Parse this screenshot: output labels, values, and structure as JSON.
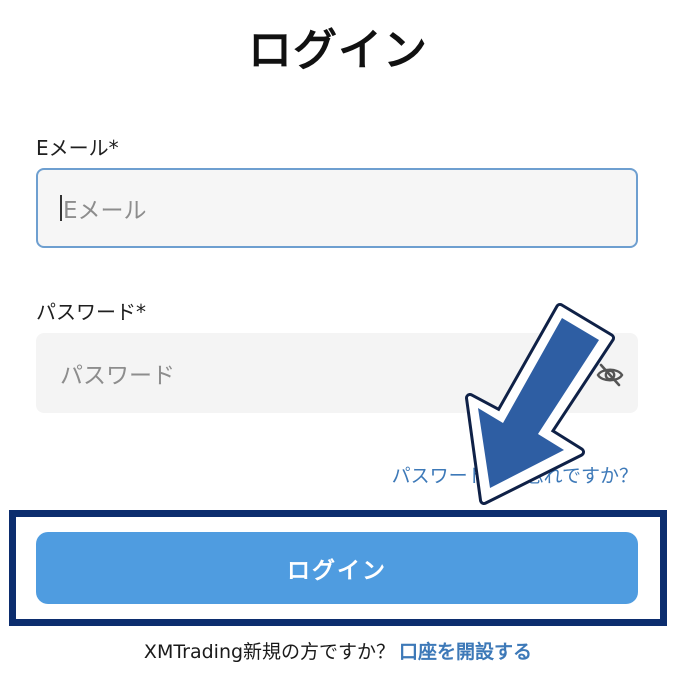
{
  "page": {
    "title": "ログイン"
  },
  "form": {
    "email_label": "Eメール*",
    "email_placeholder": "Eメール",
    "password_label": "パスワード*",
    "password_placeholder": "パスワード",
    "forgot_link": "パスワードをお忘れですか？",
    "login_button": "ログイン"
  },
  "footer": {
    "signup_prompt": "XMTrading新規の方ですか？",
    "signup_link": "口座を開設する"
  },
  "icons": {
    "password_toggle": "eye-slash-icon",
    "annotation_arrow": "arrow-down-left-icon"
  },
  "colors": {
    "accent": "#4f9ce0",
    "link": "#3d79b8",
    "highlight_frame": "#0c2d6e",
    "arrow_fill": "#2e5ea3"
  }
}
